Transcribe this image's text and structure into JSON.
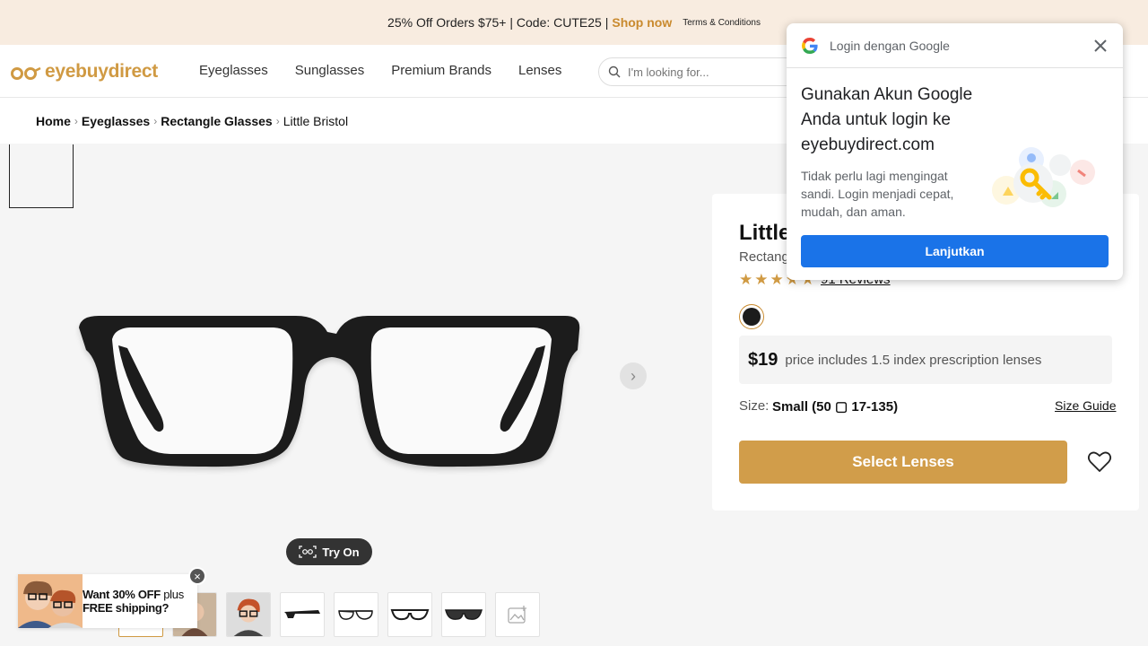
{
  "promo": {
    "text": "25% Off Orders $75+ | Code: CUTE25 |",
    "shop_now": "Shop now",
    "terms": "Terms & Conditions"
  },
  "header": {
    "logo": "eyebuydirect",
    "nav": [
      "Eyeglasses",
      "Sunglasses",
      "Premium Brands",
      "Lenses"
    ],
    "search_placeholder": "I'm looking for..."
  },
  "breadcrumb": [
    "Home",
    "Eyeglasses",
    "Rectangle Glasses",
    "Little Bristol"
  ],
  "gallery": {
    "try_on": "Try On",
    "thumbnail_count": 8
  },
  "promo_popup": {
    "line1_bold": "Want 30% OFF",
    "line1_rest": " plus",
    "line2": "FREE shipping?"
  },
  "product": {
    "title": "Little Bristol",
    "subtitle": "Rectangle",
    "rating": 5,
    "reviews": "91 Reviews",
    "color_hex": "#1c1c1c",
    "price": "$19",
    "price_note": "price includes 1.5 index prescription lenses",
    "size_label": "Size:",
    "size_value": "Small (50 ▢ 17-135)",
    "size_guide": "Size Guide",
    "select_button": "Select Lenses"
  },
  "google_popup": {
    "title": "Login dengan Google",
    "heading": "Gunakan Akun Google Anda untuk login ke eyebuydirect.com",
    "description": "Tidak perlu lagi mengingat sandi. Login menjadi cepat, mudah, dan aman.",
    "button": "Lanjutkan"
  },
  "colors": {
    "accent": "#d19d4a",
    "google_blue": "#1a73e8",
    "promo_bg": "#f8ece0"
  }
}
